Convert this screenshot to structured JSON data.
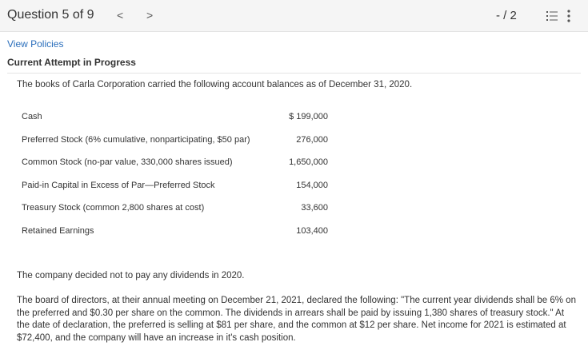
{
  "header": {
    "question_label": "Question 5 of 9",
    "prev_icon": "chevron-left-icon",
    "prev_glyph": "<",
    "next_icon": "chevron-right-icon",
    "next_glyph": ">",
    "score": "- / 2",
    "list_icon": "question-list-icon",
    "more_icon": "more-vertical-icon"
  },
  "links": {
    "view_policies": "View Policies"
  },
  "attempt_label": "Current Attempt in Progress",
  "problem": {
    "intro": "The books of Carla Corporation carried the following account balances as of December 31, 2020.",
    "accounts": [
      {
        "name": "Cash",
        "amount": "$ 199,000"
      },
      {
        "name": "Preferred Stock (6% cumulative, nonparticipating, $50 par)",
        "amount": "276,000"
      },
      {
        "name": "Common Stock (no-par value, 330,000 shares issued)",
        "amount": "1,650,000"
      },
      {
        "name": "Paid-in Capital in Excess of Par—Preferred Stock",
        "amount": "154,000"
      },
      {
        "name": "Treasury Stock (common 2,800 shares at cost)",
        "amount": "33,600"
      },
      {
        "name": "Retained Earnings",
        "amount": "103,400"
      }
    ],
    "paragraph1": "The company decided not to pay any dividends in 2020.",
    "paragraph2": "The board of directors, at their annual meeting on December 21, 2021, declared the following: \"The current year dividends shall be 6% on the preferred and $0.30 per share on the common. The dividends in arrears shall be paid by issuing 1,380 shares of treasury stock.\" At the date of declaration, the preferred is selling at $81 per share, and the common at $12 per share. Net income for 2021 is estimated at $72,400, and the company will have an increase in it's cash position."
  },
  "colors": {
    "link": "#2a6ebb",
    "topbar_bg": "#f5f5f5",
    "text": "#333333"
  }
}
